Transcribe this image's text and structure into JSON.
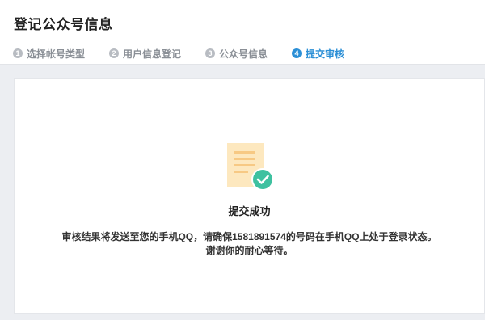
{
  "header": {
    "title": "登记公众号信息"
  },
  "steps": [
    {
      "num": "1",
      "label": "选择帐号类型",
      "active": false
    },
    {
      "num": "2",
      "label": "用户信息登记",
      "active": false
    },
    {
      "num": "3",
      "label": "公众号信息",
      "active": false
    },
    {
      "num": "4",
      "label": "提交审核",
      "active": true
    }
  ],
  "result": {
    "icon": "document-check-icon",
    "title": "提交成功",
    "message_line1": "审核结果将发送至您的手机QQ，请确保1581891574的号码在手机QQ上处于登录状态。",
    "message_line2": "谢谢你的耐心等待。"
  },
  "colors": {
    "accent": "#2b8fd6",
    "success": "#3ec1a0",
    "doc": "#fde8bf"
  }
}
